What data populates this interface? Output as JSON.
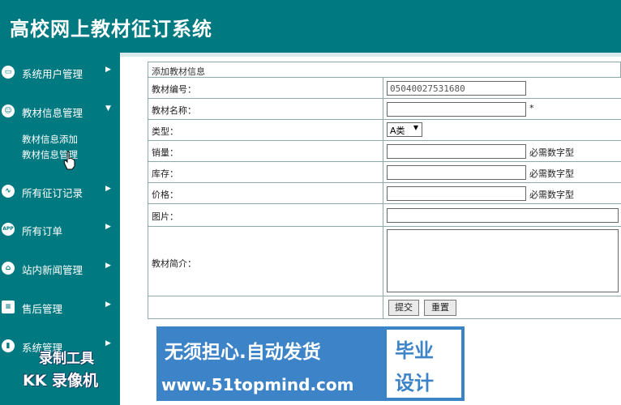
{
  "header": {
    "title": "高校网上教材征订系统"
  },
  "sidebar": {
    "items": [
      {
        "label": "系统用户管理",
        "icon": "monitor-icon",
        "caret": "▶"
      },
      {
        "label": "教材信息管理",
        "icon": "user-gear-icon",
        "caret": "▼"
      },
      {
        "label": "所有征订记录",
        "icon": "wave-icon",
        "caret": "▶"
      },
      {
        "label": "所有订单",
        "icon": "app-icon",
        "icon_text": "APP",
        "caret": "▶"
      },
      {
        "label": "站内新闻管理",
        "icon": "home-icon",
        "caret": "▶"
      },
      {
        "label": "售后管理",
        "icon": "stack-icon",
        "caret": "▶"
      },
      {
        "label": "系统管理",
        "icon": "chart-icon",
        "caret": "▶"
      }
    ],
    "subitems": [
      {
        "label": "教材信息添加"
      },
      {
        "label": "教材信息管理"
      }
    ]
  },
  "form": {
    "caption": "添加教材信息",
    "fields": {
      "code": {
        "label": "教材编号：",
        "value": "05040027531680"
      },
      "name": {
        "label": "教材名称：",
        "value": "",
        "required_mark": "*"
      },
      "type": {
        "label": "类型：",
        "selected": "A类"
      },
      "sales": {
        "label": "销量：",
        "value": "",
        "hint": "必需数字型"
      },
      "stock": {
        "label": "库存：",
        "value": "",
        "hint": "必需数字型"
      },
      "price": {
        "label": "价格：",
        "value": "",
        "hint": "必需数字型"
      },
      "image": {
        "label": "图片：",
        "value": ""
      },
      "intro": {
        "label": "教材简介：",
        "value": ""
      }
    },
    "buttons": {
      "submit": "提交",
      "reset": "重置"
    }
  },
  "watermark": {
    "banner_line1": "无须担心.自动发货",
    "banner_line2": "www.51topmind.com",
    "side_line1": "毕业",
    "side_line2": "设计",
    "recorder_line1": "录制工具",
    "recorder_line2": "KK 录像机"
  },
  "colors": {
    "primary": "#007a80",
    "banner": "#3c83c8",
    "border": "#8ea9aa"
  }
}
